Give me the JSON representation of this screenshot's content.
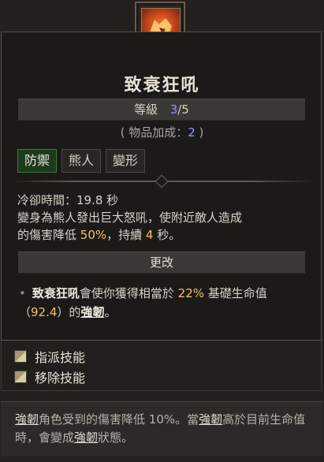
{
  "skill": {
    "name": "致衰狂吼",
    "icon": "roaring-beast-head-icon",
    "rank_label": "等級",
    "rank_current": "3",
    "rank_max": "/5",
    "bonus_prefix": "( 物品加成：",
    "bonus_value": "2",
    "bonus_suffix": " )",
    "tags": [
      "防禦",
      "熊人",
      "變形"
    ],
    "cooldown_label": "冷卻時間：",
    "cooldown_value": "19.8 秒",
    "desc_line1": "變身為熊人發出巨大怒吼，使附近敵人造成",
    "desc_line2_a": "的傷害降低 ",
    "desc_pct": "50%",
    "desc_line2_b": "，持續 ",
    "desc_duration": "4",
    "desc_line2_c": " 秒。"
  },
  "modifier": {
    "section_title": "更改",
    "skill_name": "致衰狂吼",
    "text_a": "會使你獲得相當於 ",
    "pct": "22%",
    "text_b": " 基礎生命值（",
    "amount": "92.4",
    "text_c": "）的",
    "keyword": "強韌",
    "text_d": "。"
  },
  "actions": [
    {
      "label": "指派技能",
      "key_icon": "mouse-left-icon"
    },
    {
      "label": "移除技能",
      "key_icon": "mouse-right-icon"
    }
  ],
  "tooltip": {
    "kw1": "強韌",
    "t1": "角色受到的傷害降低 10%。當",
    "kw2": "強韌",
    "t2": "高於目前生命值時，會變成",
    "kw3": "強韌",
    "t3": "狀態。"
  },
  "colors": {
    "accent_blue": "#8f97ff",
    "highlight_gold": "#f3c16a",
    "active_tag_green": "#1d3a1c"
  }
}
